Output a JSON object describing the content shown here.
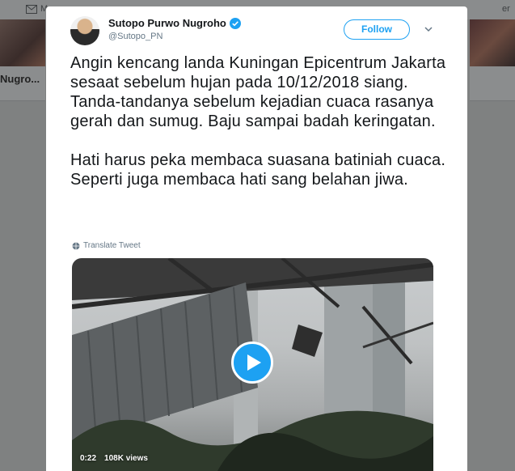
{
  "background": {
    "nav_messages_label": "M",
    "nav_right_fragment": "er",
    "left_card_name": "Nugro...",
    "right_card_name": ""
  },
  "tweet": {
    "author": {
      "name": "Sutopo Purwo Nugroho",
      "handle": "@Sutopo_PN",
      "verified": true
    },
    "follow_label": "Follow",
    "paragraphs": [
      "Angin kencang landa Kuningan Epicentrum Jakarta sesaat sebelum hujan pada 10/12/2018 siang. Tanda-tandanya sebelum kejadian cuaca rasanya gerah dan sumug. Baju sampai badah keringatan.",
      "Hati harus peka membaca suasana batiniah cuaca. Seperti juga membaca hati sang belahan jiwa."
    ],
    "translate_label": "Translate Tweet",
    "video": {
      "duration": "0:22",
      "views": "108K views"
    }
  },
  "colors": {
    "accent": "#1da1f2",
    "overlay": "#7f8181",
    "text": "#14171a",
    "secondary_text": "#657786"
  },
  "icons": [
    "mail-icon",
    "verified-icon",
    "caret-down-icon",
    "globe-icon",
    "play-icon"
  ]
}
